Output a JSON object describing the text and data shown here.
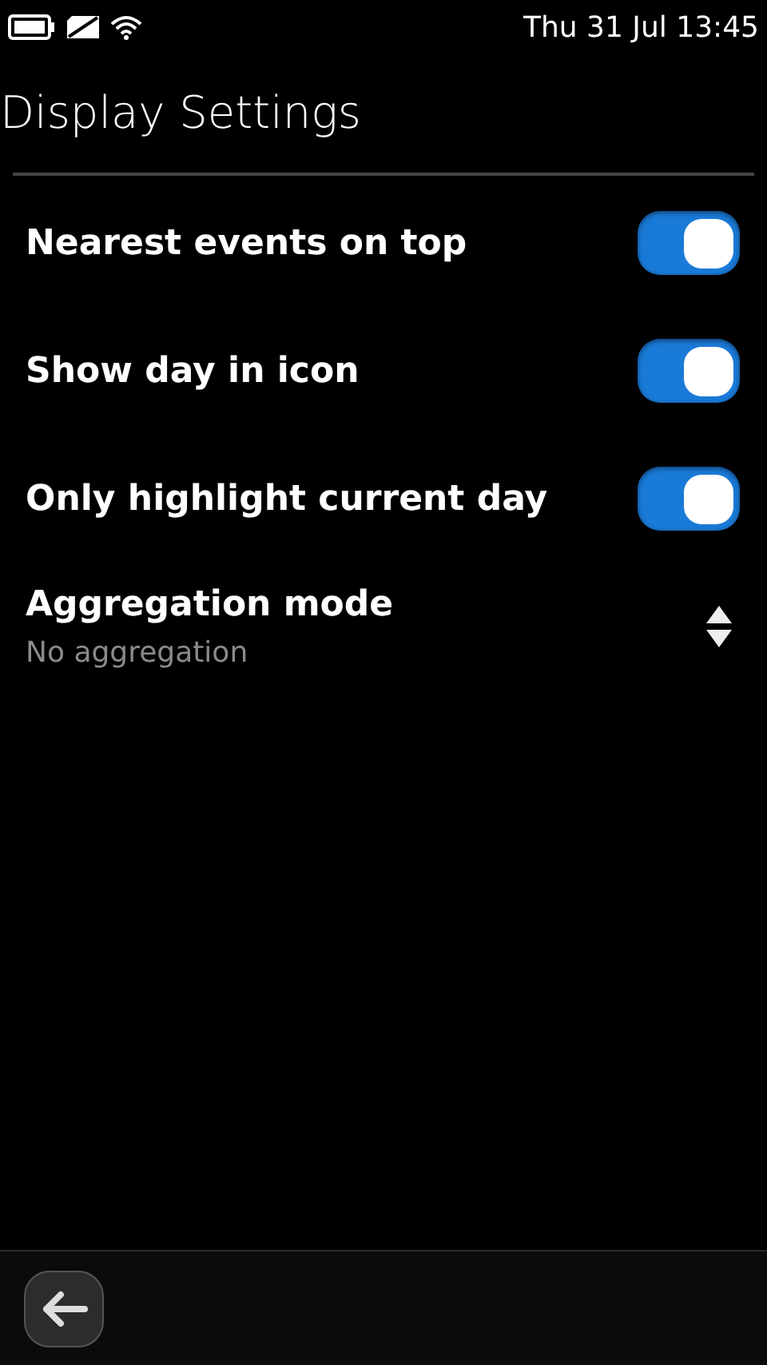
{
  "status_bar": {
    "clock": "Thu 31 Jul 13:45"
  },
  "title": "Display Settings",
  "settings": [
    {
      "kind": "toggle",
      "label": "Nearest events on top",
      "on": true
    },
    {
      "kind": "toggle",
      "label": "Show day in icon",
      "on": true
    },
    {
      "kind": "toggle",
      "label": "Only highlight current day",
      "on": true
    },
    {
      "kind": "select",
      "label": "Aggregation mode",
      "value": "No aggregation"
    }
  ]
}
